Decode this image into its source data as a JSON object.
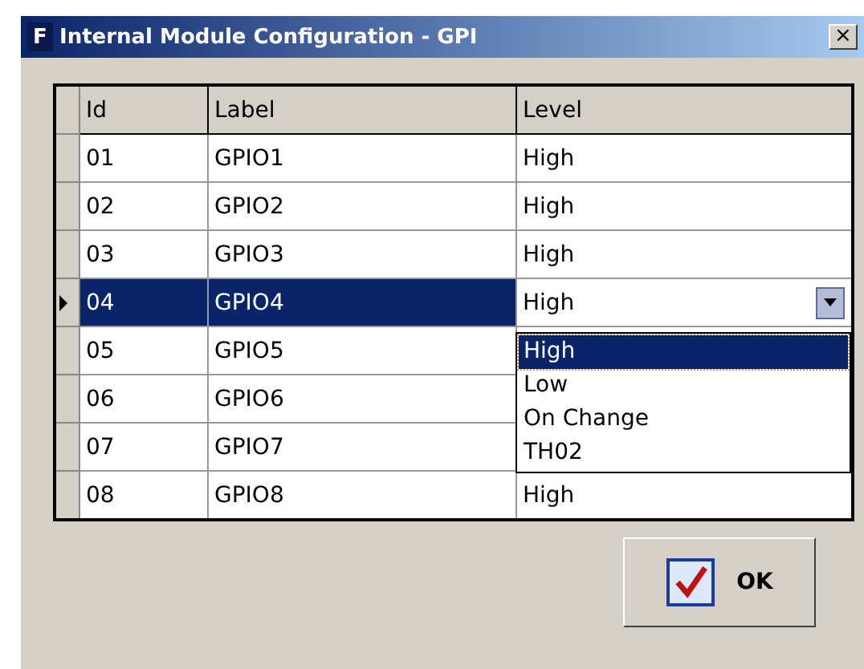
{
  "window": {
    "icon_letter": "F",
    "title": "Internal Module Configuration - GPI",
    "close": "×"
  },
  "table": {
    "columns": [
      "Id",
      "Label",
      "Level"
    ],
    "rows": [
      {
        "id": "01",
        "label": "GPIO1",
        "level": "High",
        "selected": false
      },
      {
        "id": "02",
        "label": "GPIO2",
        "level": "High",
        "selected": false
      },
      {
        "id": "03",
        "label": "GPIO3",
        "level": "High",
        "selected": false
      },
      {
        "id": "04",
        "label": "GPIO4",
        "level": "High",
        "selected": true
      },
      {
        "id": "05",
        "label": "GPIO5",
        "selected": false
      },
      {
        "id": "06",
        "label": "GPIO6",
        "selected": false
      },
      {
        "id": "07",
        "label": "GPIO7",
        "selected": false
      },
      {
        "id": "08",
        "label": "GPIO8",
        "level": "High",
        "selected": false
      }
    ]
  },
  "dropdown": {
    "options": [
      {
        "label": "High",
        "selected": true
      },
      {
        "label": "Low",
        "selected": false
      },
      {
        "label": "On Change",
        "selected": false
      },
      {
        "label": "TH02",
        "selected": false
      }
    ]
  },
  "buttons": [
    {
      "label": "OK"
    }
  ]
}
